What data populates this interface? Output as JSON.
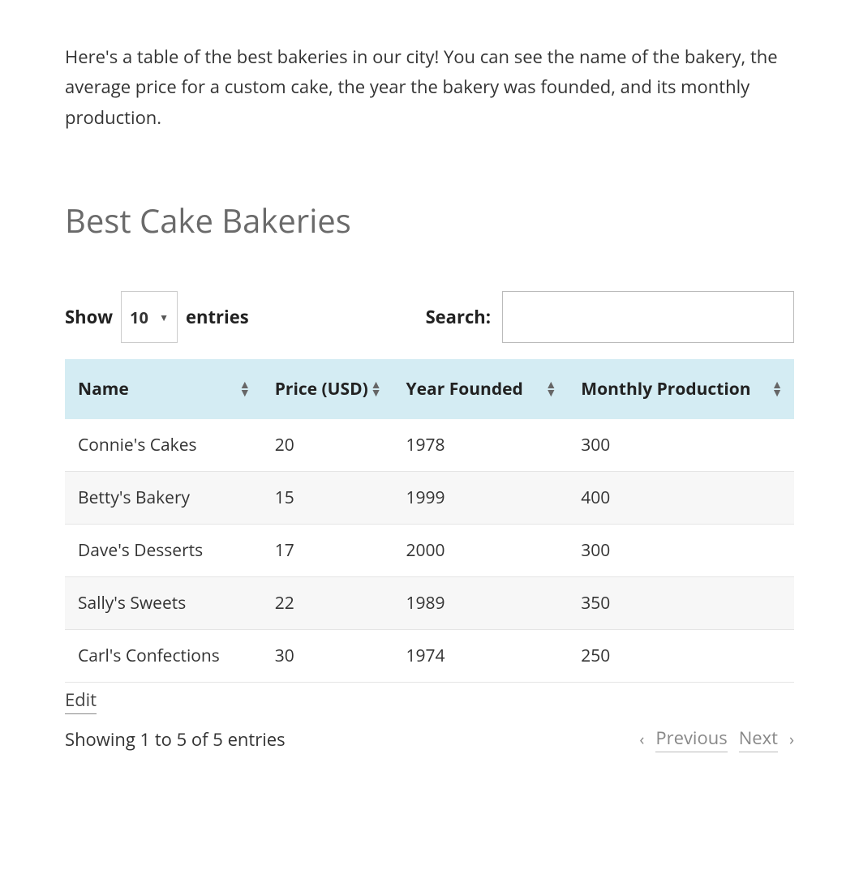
{
  "intro": "Here's a table of the best bakeries in our city! You can see the name of the bakery, the average price for a custom cake, the year the bakery was founded, and its monthly production.",
  "section_title": "Best Cake Bakeries",
  "controls": {
    "show_label": "Show",
    "entries_label": "entries",
    "entries_value": "10",
    "search_label": "Search:",
    "search_value": ""
  },
  "table": {
    "headers": {
      "name": "Name",
      "price": "Price (USD)",
      "year": "Year Founded",
      "production": "Monthly Production"
    },
    "rows": [
      {
        "name": "Connie's Cakes",
        "price": "20",
        "year": "1978",
        "production": "300"
      },
      {
        "name": "Betty's Bakery",
        "price": "15",
        "year": "1999",
        "production": "400"
      },
      {
        "name": "Dave's Desserts",
        "price": "17",
        "year": "2000",
        "production": "300"
      },
      {
        "name": "Sally's Sweets",
        "price": "22",
        "year": "1989",
        "production": "350"
      },
      {
        "name": "Carl's Confections",
        "price": "30",
        "year": "1974",
        "production": "250"
      }
    ]
  },
  "edit_label": "Edit",
  "footer": {
    "info": "Showing 1 to 5 of 5 entries",
    "previous": "Previous",
    "next": "Next"
  },
  "chart_data": {
    "type": "table",
    "title": "Best Cake Bakeries",
    "columns": [
      "Name",
      "Price (USD)",
      "Year Founded",
      "Monthly Production"
    ],
    "rows": [
      [
        "Connie's Cakes",
        20,
        1978,
        300
      ],
      [
        "Betty's Bakery",
        15,
        1999,
        400
      ],
      [
        "Dave's Desserts",
        17,
        2000,
        300
      ],
      [
        "Sally's Sweets",
        22,
        1989,
        350
      ],
      [
        "Carl's Confections",
        30,
        1974,
        250
      ]
    ]
  }
}
